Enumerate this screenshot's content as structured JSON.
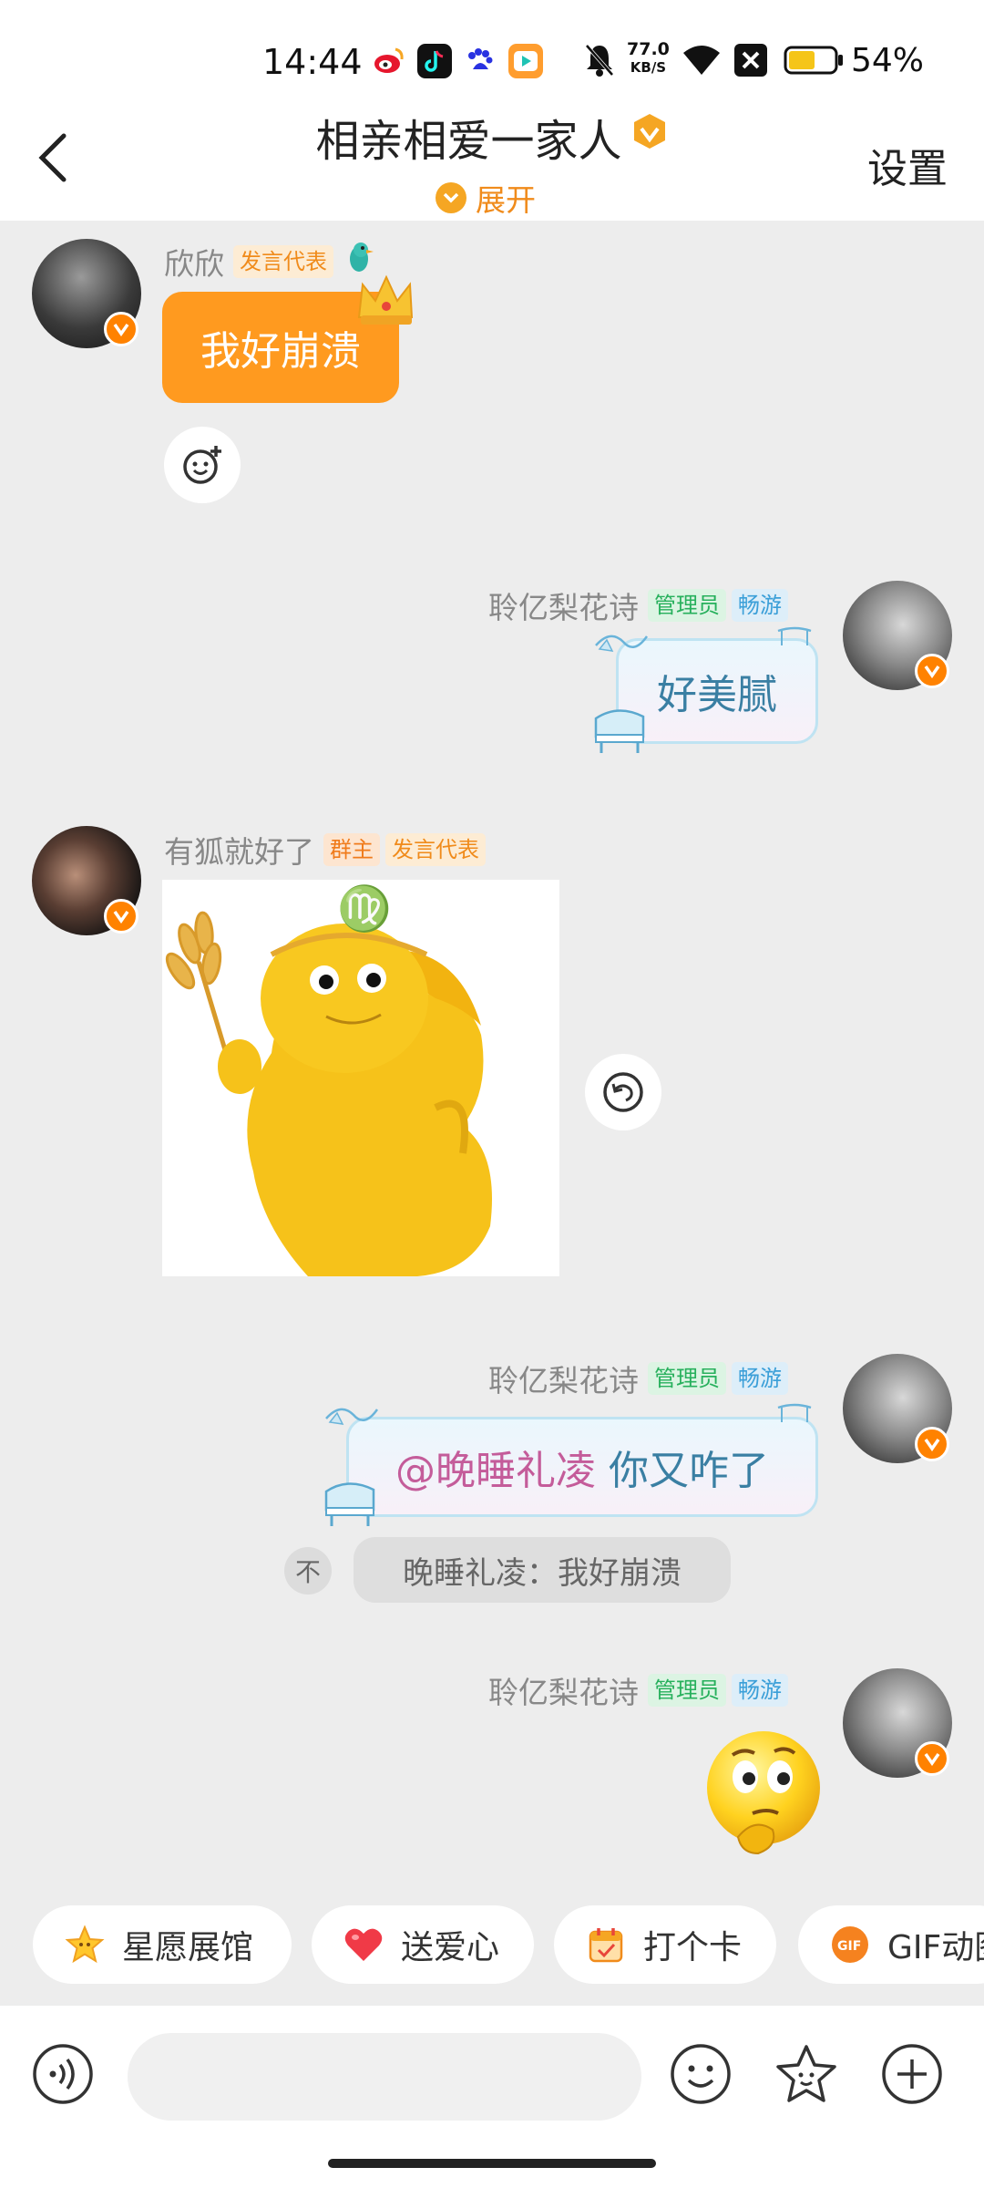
{
  "status_bar": {
    "time": "14:44",
    "net_speed": "77.0",
    "net_unit": "KB/S",
    "battery": "54%"
  },
  "header": {
    "title": "相亲相爱一家人",
    "expand": "展开",
    "settings": "设置"
  },
  "messages": {
    "m1": {
      "sender": "欣欣",
      "tag1": "发言代表",
      "text": "我好崩溃"
    },
    "m2": {
      "sender": "聆亿梨花诗",
      "tag1": "管理员",
      "tag2": "畅游",
      "text": "好美腻"
    },
    "m3": {
      "sender": "有狐就好了",
      "tag1": "群主",
      "tag2": "发言代表"
    },
    "m4": {
      "sender": "聆亿梨花诗",
      "tag1": "管理员",
      "tag2": "畅游",
      "mention": "@晚睡礼凌",
      "text": "你又咋了",
      "quote_icon": "不",
      "quote": "晚睡礼凌：我好崩溃"
    },
    "m5": {
      "sender": "聆亿梨花诗",
      "tag1": "管理员",
      "tag2": "畅游"
    }
  },
  "quick_actions": [
    {
      "label": "星愿展馆",
      "icon": "star-icon"
    },
    {
      "label": "送爱心",
      "icon": "heart-icon"
    },
    {
      "label": "打个卡",
      "icon": "calendar-icon"
    },
    {
      "label": "GIF动图",
      "icon": "gif-icon"
    }
  ],
  "input": {
    "placeholder": ""
  },
  "colors": {
    "accent": "#ff8200",
    "bubble_orange": "#ff9a1f",
    "admin_green": "#27b05c",
    "vip_blue": "#3b9fd8"
  }
}
